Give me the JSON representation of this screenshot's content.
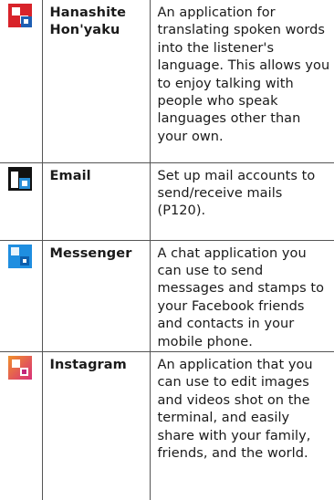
{
  "apps": [
    {
      "icon": "hanashite-honyaku-icon",
      "name": "Hanashite Hon'yaku",
      "description": "An application for translating spoken words into the listener's language. This allows you to enjoy talking with people who speak languages other than your own."
    },
    {
      "icon": "email-icon",
      "name": "Email",
      "description": "Set up mail accounts to send/receive mails (P120)."
    },
    {
      "icon": "messenger-icon",
      "name": "Messenger",
      "description": "A chat application you can use to send messages and stamps to your Facebook friends and contacts in your mobile phone."
    },
    {
      "icon": "instagram-icon",
      "name": "Instagram",
      "description": "An application that you can use to edit images and videos shot on the terminal, and easily share with your family, friends, and the world."
    }
  ],
  "colors": {
    "border": "#555555",
    "hanashite_red": "#d8232a",
    "hanashite_blue": "#1e5fb3",
    "email_black": "#111111",
    "email_blue": "#2a8fd8",
    "messenger_blue": "#1f8ee0",
    "instagram_orange": "#f0902a",
    "instagram_pink": "#d8307a"
  }
}
